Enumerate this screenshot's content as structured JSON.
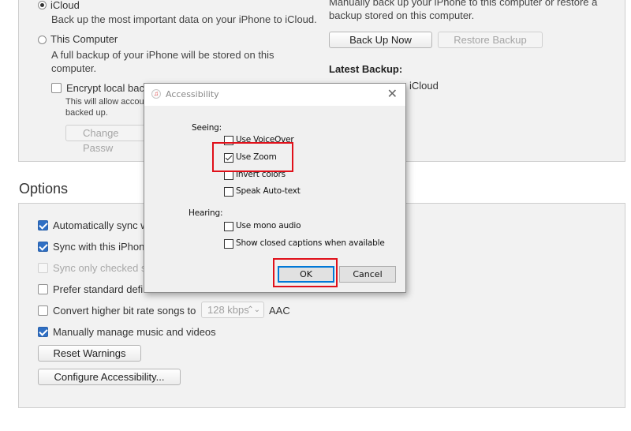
{
  "backups": {
    "icloud_label": "iCloud",
    "icloud_desc": "Back up the most important data on your iPhone to iCloud.",
    "computer_label": "This Computer",
    "computer_desc_line1": "A full backup of your iPhone will be stored on this",
    "computer_desc_line2": "computer.",
    "encrypt_label": "Encrypt local back",
    "encrypt_desc_line1": "This will allow account",
    "encrypt_desc_line2": "backed up.",
    "change_password_label": "Change Passw",
    "manual_desc_line1": "Manually back up your iPhone to this computer or restore a",
    "manual_desc_line2": "backup stored on this computer.",
    "back_up_now_label": "Back Up Now",
    "restore_backup_label": "Restore Backup",
    "latest_backup_heading": "Latest Backup:",
    "latest_backup_value": "iCloud"
  },
  "options": {
    "heading": "Options",
    "items": [
      {
        "label": "Automatically sync w",
        "checked": true,
        "disabled": false
      },
      {
        "label": "Sync with this iPhone",
        "checked": true,
        "disabled": false
      },
      {
        "label": "Sync only checked so",
        "checked": false,
        "disabled": true
      },
      {
        "label": "Prefer standard defin",
        "checked": false,
        "disabled": false
      },
      {
        "label": "Convert higher bit rate songs to",
        "checked": false,
        "disabled": false
      },
      {
        "label": "Manually manage music and videos",
        "checked": true,
        "disabled": false
      }
    ],
    "bitrate_value": "128 kbps",
    "bitrate_format": "AAC",
    "reset_warnings_label": "Reset Warnings",
    "configure_accessibility_label": "Configure Accessibility..."
  },
  "dialog": {
    "title": "Accessibility",
    "seeing_label": "Seeing:",
    "seeing_options": [
      {
        "label": "Use VoiceOver",
        "checked": false
      },
      {
        "label": "Use Zoom",
        "checked": true
      },
      {
        "label": "Invert colors",
        "checked": false
      },
      {
        "label": "Speak Auto-text",
        "checked": false
      }
    ],
    "hearing_label": "Hearing:",
    "hearing_options": [
      {
        "label": "Use mono audio",
        "checked": false
      },
      {
        "label": "Show closed captions when available",
        "checked": false
      }
    ],
    "ok_label": "OK",
    "cancel_label": "Cancel"
  },
  "colors": {
    "highlight": "#e0101a",
    "checkbox_accent": "#2f6fc4",
    "dialog_default_border": "#0078d7"
  }
}
